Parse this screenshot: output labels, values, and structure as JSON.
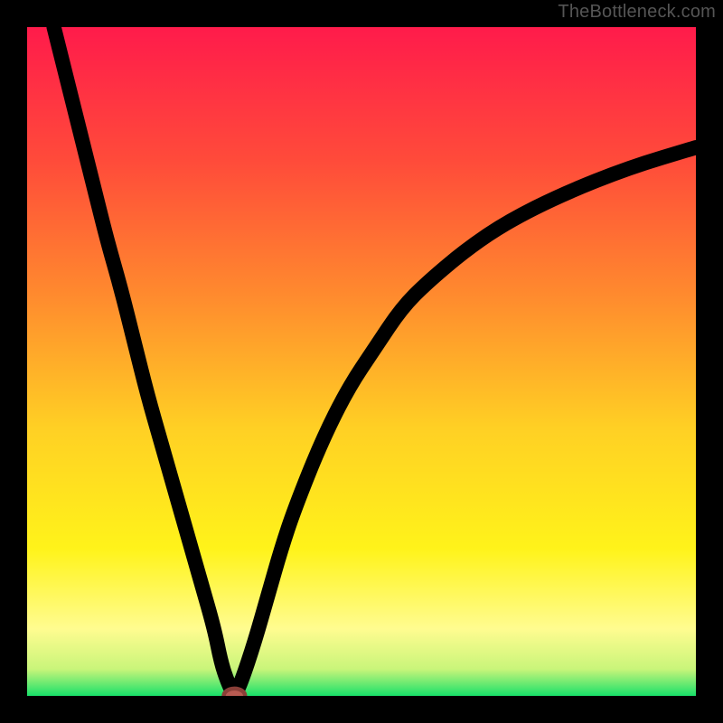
{
  "watermark": "TheBottleneck.com",
  "chart_data": {
    "type": "line",
    "title": "",
    "xlabel": "",
    "ylabel": "",
    "xlim": [
      0,
      100
    ],
    "ylim": [
      0,
      100
    ],
    "background_gradient": {
      "stops": [
        {
          "offset": 0,
          "color": "#ff1b4b"
        },
        {
          "offset": 20,
          "color": "#ff4b3a"
        },
        {
          "offset": 40,
          "color": "#ff8a2e"
        },
        {
          "offset": 60,
          "color": "#ffd024"
        },
        {
          "offset": 78,
          "color": "#fff31a"
        },
        {
          "offset": 90,
          "color": "#fffc90"
        },
        {
          "offset": 96,
          "color": "#c9f57a"
        },
        {
          "offset": 100,
          "color": "#18e06a"
        }
      ]
    },
    "series": [
      {
        "name": "bottleneck-curve",
        "x": [
          4,
          6,
          8,
          10,
          12,
          14,
          16,
          18,
          20,
          22,
          24,
          26,
          28,
          29,
          30,
          31,
          32,
          34,
          36,
          38,
          40,
          44,
          48,
          52,
          56,
          60,
          66,
          72,
          80,
          90,
          100
        ],
        "y": [
          100,
          92,
          84,
          76,
          68,
          61,
          53,
          45,
          38,
          31,
          24,
          17,
          10,
          5,
          2,
          0,
          2,
          8,
          15,
          22,
          28,
          38,
          46,
          52,
          58,
          62,
          67,
          71,
          75,
          79,
          82
        ]
      }
    ],
    "marker": {
      "x": 31,
      "y": 0,
      "rx": 1.6,
      "ry": 1.1,
      "color": "#b85b52"
    }
  }
}
